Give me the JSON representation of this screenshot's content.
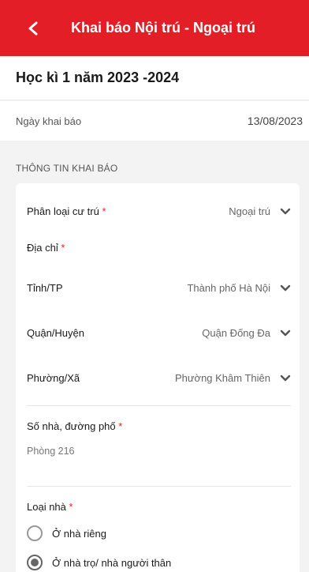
{
  "header": {
    "title": "Khai báo Nội trú - Ngoại trú"
  },
  "semester": {
    "title": "Học kì 1 năm 2023 -2024"
  },
  "declaration_date": {
    "label": "Ngày khai báo",
    "value": "13/08/2023"
  },
  "section": {
    "title": "THÔNG TIN KHAI BÁO"
  },
  "form": {
    "residence_type": {
      "label": "Phân loại cư trú",
      "required_mark": "*",
      "value": "Ngoại trú"
    },
    "address": {
      "label": "Địa chỉ",
      "required_mark": "*"
    },
    "province": {
      "label": "Tỉnh/TP",
      "value": "Thành phố Hà Nội"
    },
    "district": {
      "label": "Quận/Huyện",
      "value": "Quận Đống Đa"
    },
    "ward": {
      "label": "Phường/Xã",
      "value": "Phường Khâm Thiên"
    },
    "street": {
      "label": "Số nhà, đường phố",
      "required_mark": "*",
      "value": "Phòng 216"
    },
    "house_type": {
      "label": "Loại nhà",
      "required_mark": "*",
      "options": [
        {
          "label": "Ở nhà riêng",
          "selected": false
        },
        {
          "label": "Ở nhà trọ/ nhà người thân",
          "selected": true
        }
      ]
    }
  },
  "colors": {
    "brand": "#e41e26"
  }
}
